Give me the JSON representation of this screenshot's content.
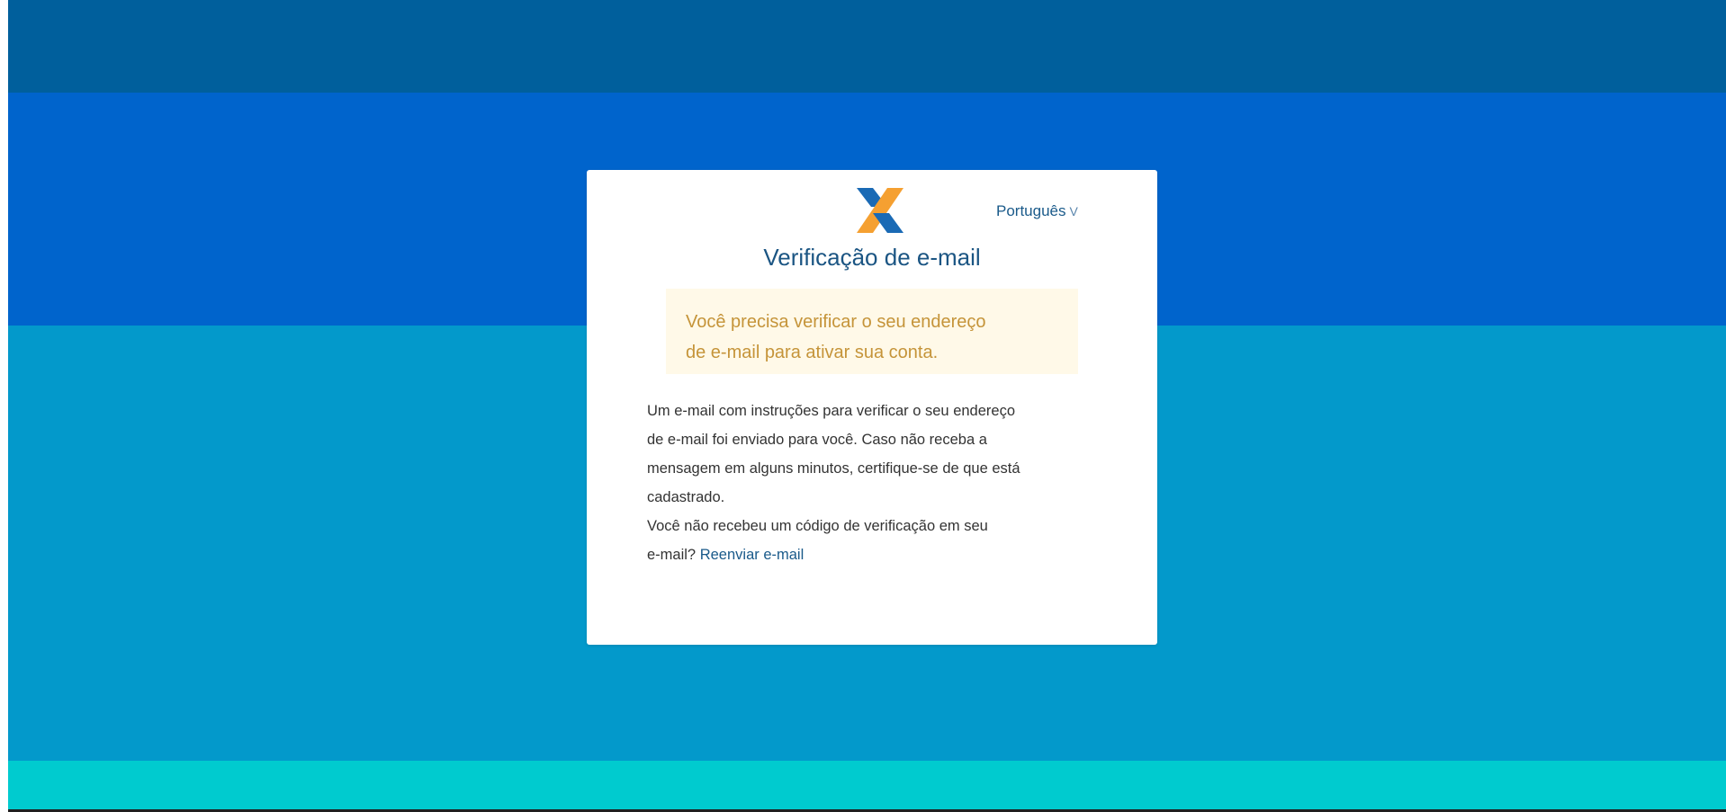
{
  "header": {
    "language_selector": {
      "label": "Português",
      "chevron": "V"
    },
    "logo": {
      "icon": "caixa-x-logo-icon",
      "colors": {
        "blue": "#1a6ab5",
        "orange": "#f5a031"
      }
    }
  },
  "card": {
    "title": "Verificação de e-mail",
    "alert": {
      "line1": "Você precisa verificar o seu endereço",
      "line2": "de e-mail para ativar sua conta."
    },
    "instructions": {
      "line1": "Um e-mail com instruções para verificar o seu endereço",
      "line2": "de e-mail foi enviado para você. Caso não receba a",
      "line3": "mensagem em alguns minutos, certifique-se de que está",
      "line4": "cadastrado.",
      "line5": "Você não recebeu um código de verificação em seu",
      "line6_prefix": "e-mail?",
      "resend_link": "Reenviar e-mail"
    }
  },
  "colors": {
    "band_top": "#005f9c",
    "band_blue": "#0064cc",
    "band_light_blue": "#0399cb",
    "band_cyan": "#00cbcf",
    "title_blue": "#1b5583",
    "alert_bg": "#fff9e8",
    "alert_text": "#c59439"
  }
}
